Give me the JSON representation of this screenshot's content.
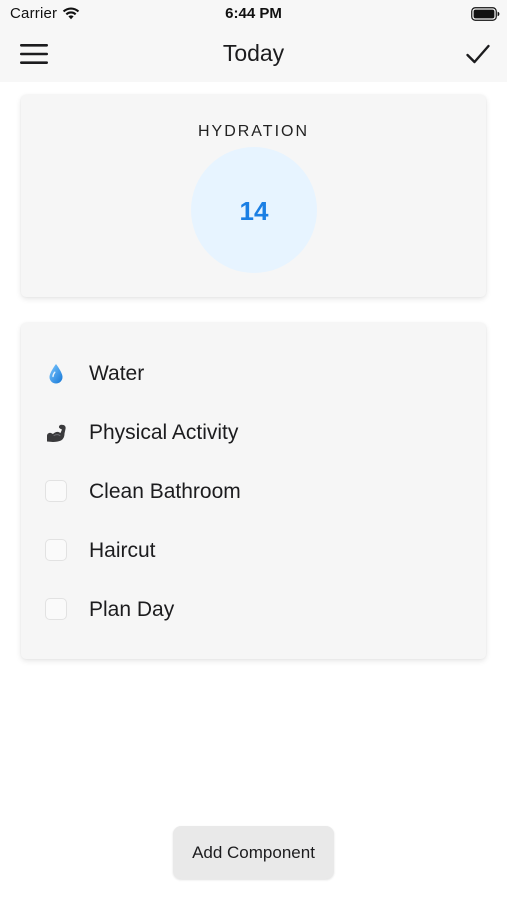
{
  "status_bar": {
    "carrier": "Carrier",
    "time": "6:44 PM",
    "icons": [
      "wifi-icon",
      "battery-icon"
    ]
  },
  "nav": {
    "title": "Today",
    "left_icon": "hamburger-menu-icon",
    "right_icon": "checkmark-icon"
  },
  "hydration": {
    "title": "HYDRATION",
    "value": "14",
    "circle_color": "#e7f4ff",
    "value_color": "#1b7fe4"
  },
  "tasks": [
    {
      "label": "Water",
      "icon": "water-drop-icon",
      "checked": null
    },
    {
      "label": "Physical Activity",
      "icon": "flexed-biceps-icon",
      "checked": null
    },
    {
      "label": "Clean Bathroom",
      "icon": "checkbox-icon",
      "checked": false
    },
    {
      "label": "Haircut",
      "icon": "checkbox-icon",
      "checked": false
    },
    {
      "label": "Plan Day",
      "icon": "checkbox-icon",
      "checked": false
    }
  ],
  "add_component": {
    "label": "Add Component"
  },
  "colors": {
    "background": "#ffffff",
    "bar_background": "#f7f7f7",
    "card_background": "#f6f6f6",
    "button_background": "#e9e9e9",
    "accent": "#1b7fe4"
  }
}
